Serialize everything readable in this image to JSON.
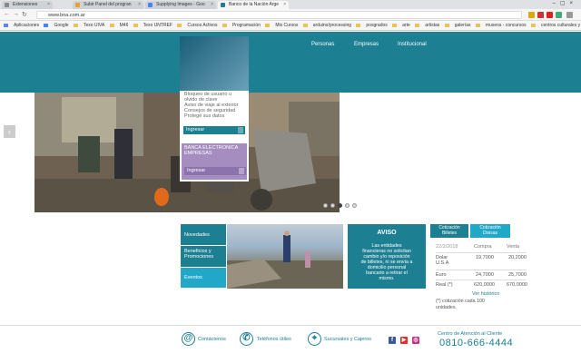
{
  "browser": {
    "tabs": [
      {
        "label": "Extensiones"
      },
      {
        "label": "Subir Panel del progran"
      },
      {
        "label": "Supplying Images - Goo"
      },
      {
        "label": "Banco de la Nación Arge"
      }
    ],
    "url": "www.bna.com.ar",
    "bookmarks": [
      "Aplicaciones",
      "Google",
      "Texo UIVA",
      "M46",
      "Texo UNTREF",
      "Cursos Activos",
      "Programación",
      "Mis Cursos",
      "arduino/processing",
      "posgrados",
      "arte",
      "artistas",
      "galerías",
      "museos - concursos",
      "centros culturales y",
      "revistas"
    ]
  },
  "nav": {
    "personas": "Personas",
    "empresas": "Empresas",
    "institucional": "Institucional"
  },
  "card": {
    "text": "Bloqueo de usuario u\nolvido de clave\nAviso de viaje al exterior\nConsejos de seguridad\nProtegé sus datos",
    "text_top": "Ingresar ",
    "ingresar": "Ingresar",
    "empresas_title": "BANCA ELECTRONICA\nEMPRESAS",
    "ingresar2": "Ingresar"
  },
  "links": [
    {
      "label": "Novedades"
    },
    {
      "label": "Beneficios y\nPromociones"
    },
    {
      "label": "Eventos"
    }
  ],
  "aviso": {
    "title": "AVISO",
    "text": "Las entidades\nfinancieras no solicitan\ncambio y/o reposición\nde billetes, ni se envía a\ndomicilio personal\nbancario a retirar el\nmismo."
  },
  "cotizacion": {
    "tab_billetes": "Cotización\nBilletes",
    "tab_divisas": "Cotización\nDivisas",
    "date": "22/2/2018",
    "col_compra": "Compra",
    "col_venta": "Venta",
    "rows": [
      {
        "name": "Dolar U.S.A",
        "compra": "19,7000",
        "venta": "20,2000"
      },
      {
        "name": "Euro",
        "compra": "24,7000",
        "venta": "25,7000"
      },
      {
        "name": "Real (*)",
        "compra": "620,0000",
        "venta": "670,0000"
      }
    ],
    "historico": "Ver histórico",
    "note": "(*) cotización cada 100 unidades."
  },
  "footer": {
    "contactenos": "Contáctenos",
    "telefonos": "Teléfonos útiles",
    "sucursales": "Sucursales y Cajeros",
    "centro": "Centro de Atención al Cliente",
    "phone": "0810-666-4444"
  },
  "colors": {
    "brand": "#1d7f92",
    "accent": "#21a8c8",
    "purple": "#a58dc0"
  }
}
